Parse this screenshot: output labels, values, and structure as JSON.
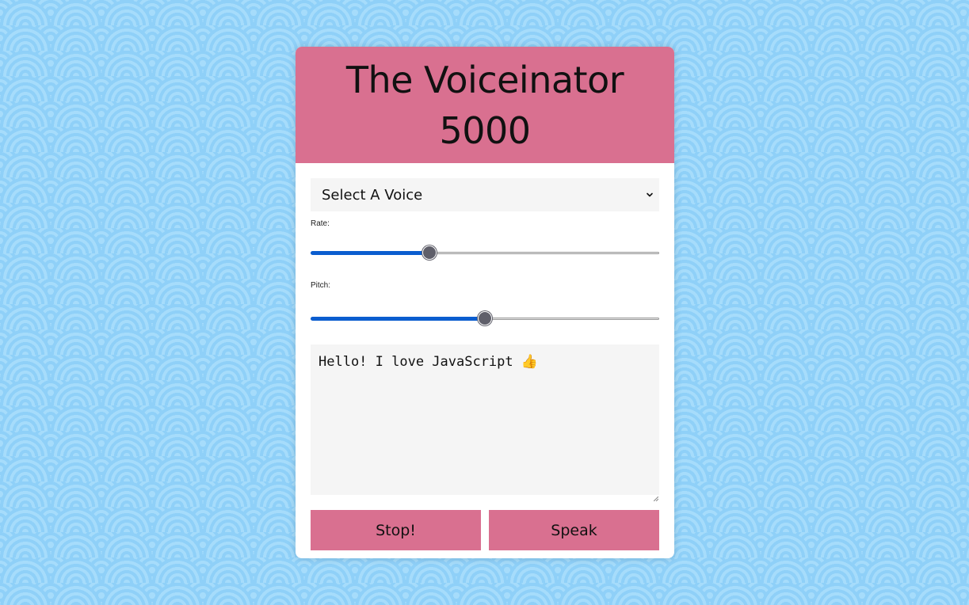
{
  "app": {
    "title": "The Voiceinator 5000"
  },
  "voice_select": {
    "selected": "Select A Voice",
    "icon": "chevron-down-icon"
  },
  "rate": {
    "label": "Rate:",
    "value_fraction": 0.34
  },
  "pitch": {
    "label": "Pitch:",
    "value_fraction": 0.5
  },
  "message": {
    "text": "Hello! I love JavaScript 👍"
  },
  "buttons": {
    "stop_label": "Stop!",
    "speak_label": "Speak"
  },
  "colors": {
    "accent": "#d97090",
    "background": "#8fd0f8",
    "slider_fill": "#0b5dcf"
  }
}
